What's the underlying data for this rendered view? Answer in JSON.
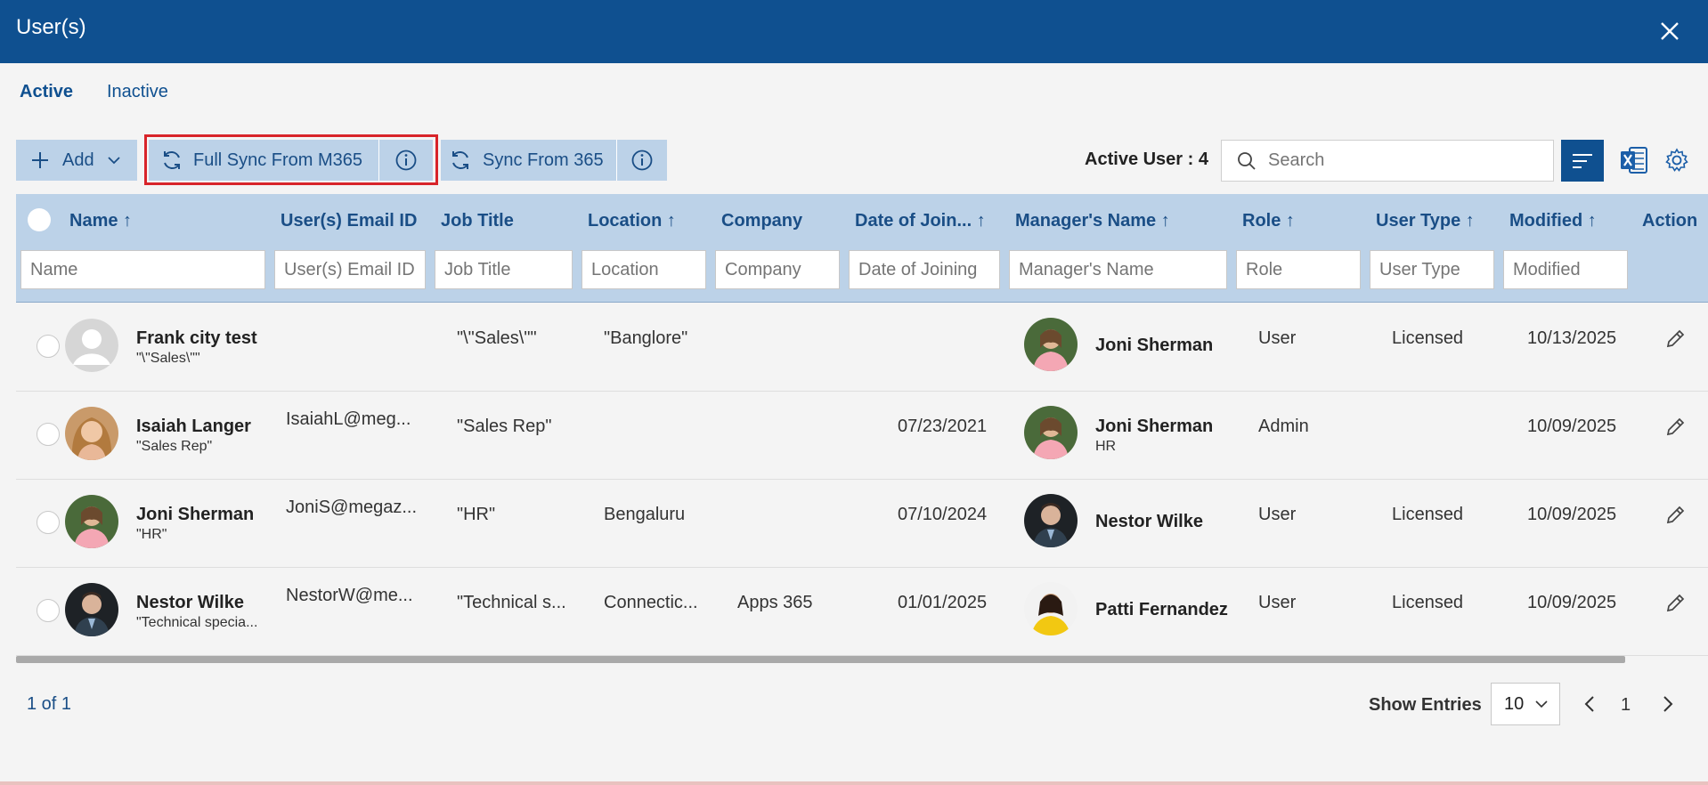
{
  "window": {
    "title": "User(s)"
  },
  "tabs": [
    {
      "label": "Active",
      "active": true
    },
    {
      "label": "Inactive",
      "active": false
    }
  ],
  "toolbar": {
    "add_label": "Add",
    "full_sync_label": "Full Sync From M365",
    "sync_label": "Sync From 365",
    "active_count": "Active User : 4",
    "search_placeholder": "Search"
  },
  "columns": {
    "name": "Name",
    "email": "User(s) Email ID",
    "job": "Job Title",
    "location": "Location",
    "company": "Company",
    "doj": "Date of Join...",
    "manager": "Manager's Name",
    "role": "Role",
    "usertype": "User Type",
    "modified": "Modified",
    "actions": "Action"
  },
  "filters": {
    "name": "Name",
    "email": "User(s) Email ID",
    "job": "Job Title",
    "location": "Location",
    "company": "Company",
    "doj": "Date of Joining",
    "manager": "Manager's Name",
    "role": "Role",
    "usertype": "User Type",
    "modified": "Modified"
  },
  "rows": [
    {
      "name": "Frank city test",
      "sub": "\"\\\"Sales\\\"\"",
      "email": "",
      "job": "\"\\\"Sales\\\"\"",
      "location": "\"Banglore\"",
      "company": "",
      "doj": "",
      "manager": "Joni Sherman",
      "manager_sub": "",
      "role": "User",
      "usertype": "Licensed",
      "modified": "10/13/2025"
    },
    {
      "name": "Isaiah Langer",
      "sub": "\"Sales Rep\"",
      "email": "IsaiahL@meg...",
      "job": "\"Sales Rep\"",
      "location": "",
      "company": "",
      "doj": "07/23/2021",
      "manager": "Joni Sherman",
      "manager_sub": "HR",
      "role": "Admin",
      "usertype": "",
      "modified": "10/09/2025"
    },
    {
      "name": "Joni Sherman",
      "sub": "\"HR\"",
      "email": "JoniS@megaz...",
      "job": "\"HR\"",
      "location": "Bengaluru",
      "company": "",
      "doj": "07/10/2024",
      "manager": "Nestor Wilke",
      "manager_sub": "",
      "role": "User",
      "usertype": "Licensed",
      "modified": "10/09/2025"
    },
    {
      "name": "Nestor Wilke",
      "sub": "\"Technical specia...",
      "email": "NestorW@me...",
      "job": "\"Technical s...",
      "location": "Connectic...",
      "company": "Apps 365",
      "doj": "01/01/2025",
      "manager": "Patti Fernandez",
      "manager_sub": "",
      "role": "User",
      "usertype": "Licensed",
      "modified": "10/09/2025"
    }
  ],
  "footer": {
    "page_info": "1 of 1",
    "show_entries_label": "Show Entries",
    "entries_value": "10",
    "current_page": "1"
  },
  "colors": {
    "brand": "#0f5090",
    "header_bg": "#bcd2e8",
    "highlight": "#d8242a"
  }
}
